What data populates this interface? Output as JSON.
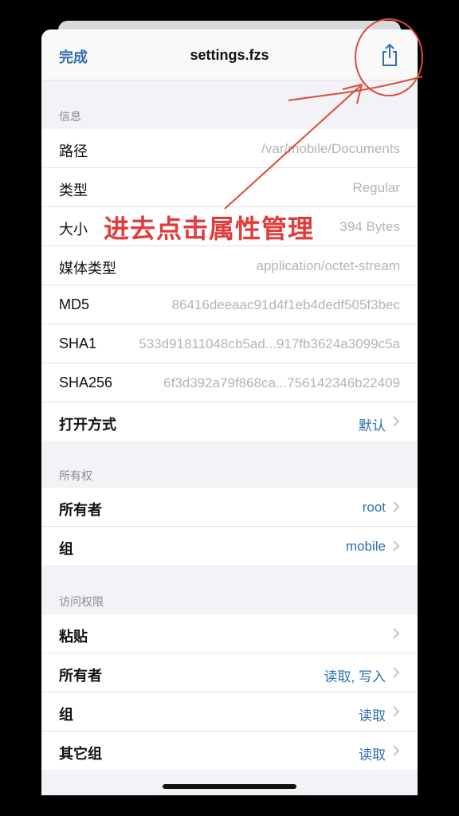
{
  "nav": {
    "done": "完成",
    "title": "settings.fzs"
  },
  "info": {
    "section": "信息",
    "rows": [
      {
        "label": "路径",
        "value": "/var/mobile/Documents"
      },
      {
        "label": "类型",
        "value": "Regular"
      },
      {
        "label": "大小",
        "value": "394 Bytes"
      },
      {
        "label": "媒体类型",
        "value": "application/octet-stream"
      },
      {
        "label": "MD5",
        "value": "86416deeaac91d4f1eb4dedf505f3bec"
      },
      {
        "label": "SHA1",
        "value": "533d91811048cb5ad...917fb3624a3099c5a"
      },
      {
        "label": "SHA256",
        "value": "6f3d392a79f868ca...756142346b22409"
      },
      {
        "label": "打开方式",
        "value": "默认"
      }
    ]
  },
  "ownership": {
    "section": "所有权",
    "rows": [
      {
        "label": "所有者",
        "value": "root"
      },
      {
        "label": "组",
        "value": "mobile"
      }
    ]
  },
  "permissions": {
    "section": "访问权限",
    "rows": [
      {
        "label": "粘贴",
        "value": ""
      },
      {
        "label": "所有者",
        "value": "读取, 写入"
      },
      {
        "label": "组",
        "value": "读取"
      },
      {
        "label": "其它组",
        "value": "读取"
      }
    ]
  },
  "annotation": {
    "text": "进去点击属性管理"
  },
  "colors": {
    "accent": "#2f6fb0",
    "annotation": "#e23b3b"
  },
  "icons": {
    "share": "share-icon",
    "chevron": "chevron-right-icon"
  }
}
